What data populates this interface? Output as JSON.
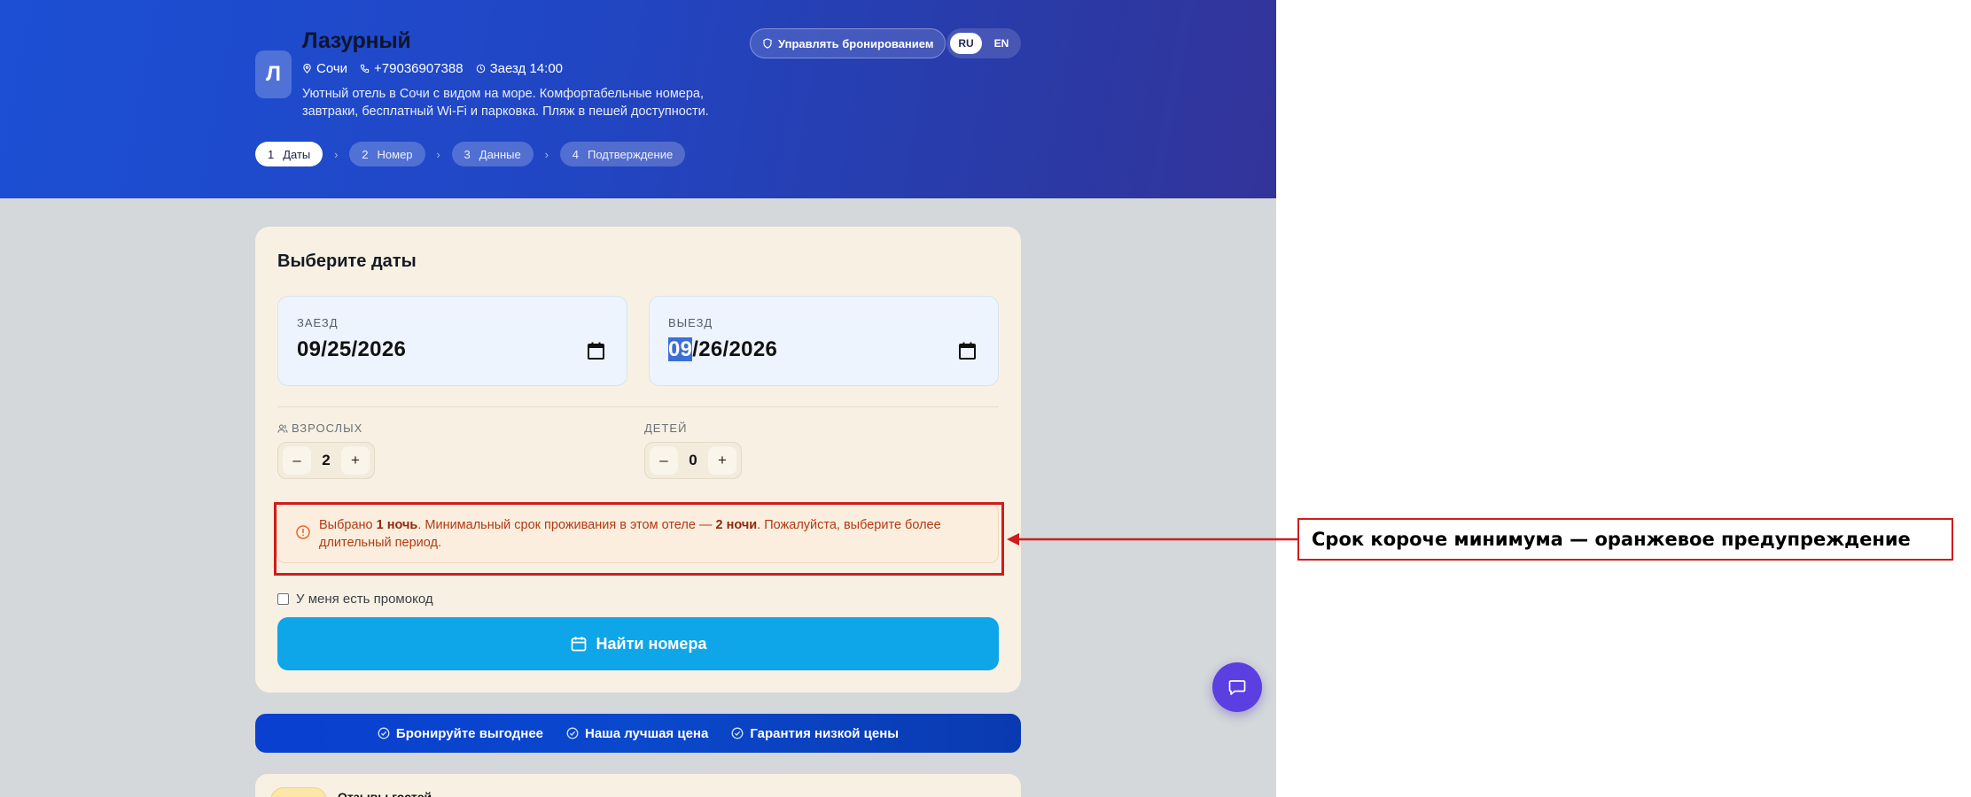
{
  "header": {
    "avatar_letter": "Л",
    "hotel_name": "Лазурный",
    "city": "Сочи",
    "phone": "+79036907388",
    "checkin_time": "Заезд 14:00",
    "description": "Уютный отель в Сочи с видом на море. Комфортабельные номера, завтраки, бесплатный Wi-Fi и парковка. Пляж в пешей доступности.",
    "manage_button": "Управлять бронированием",
    "languages": [
      "RU",
      "EN"
    ],
    "active_language": "RU"
  },
  "steps": [
    {
      "num": "1",
      "label": "Даты",
      "active": true
    },
    {
      "num": "2",
      "label": "Номер",
      "active": false
    },
    {
      "num": "3",
      "label": "Данные",
      "active": false
    },
    {
      "num": "4",
      "label": "Подтверждение",
      "active": false
    }
  ],
  "dates_card": {
    "title": "Выберите даты",
    "checkin": {
      "label": "ЗАЕЗД",
      "value": "09/25/2026"
    },
    "checkout": {
      "label": "ВЫЕЗД",
      "value_selected": "09",
      "value_rest": "/26/2026"
    },
    "adults": {
      "label": "ВЗРОСЛЫХ",
      "value": "2",
      "minus": "–",
      "plus": "+"
    },
    "children": {
      "label": "ДЕТЕЙ",
      "value": "0",
      "minus": "–",
      "plus": "+"
    },
    "warning": {
      "part1": "Выбрано ",
      "bold1": "1 ночь",
      "part2": ". Минимальный срок проживания в этом отеле — ",
      "bold2": "2 ночи",
      "part3": ". Пожалуйста, выберите более длительный период."
    },
    "promo_label": "У меня есть промокод",
    "search_button": "Найти номера"
  },
  "benefits": [
    "Бронируйте выгоднее",
    "Наша лучшая цена",
    "Гарантия низкой цены"
  ],
  "reviews": {
    "title": "Отзывы гостей"
  },
  "annotation": {
    "callout": "Срок короче минимума — оранжевое предупреждение"
  },
  "colors": {
    "header_gradient_start": "#1c4fd4",
    "card_background": "#f8f1e3",
    "warning_text": "#b23a14",
    "search_button": "#0ea5e9",
    "chat_button": "#5b3fe0",
    "annotation_red": "#d01c1c"
  }
}
